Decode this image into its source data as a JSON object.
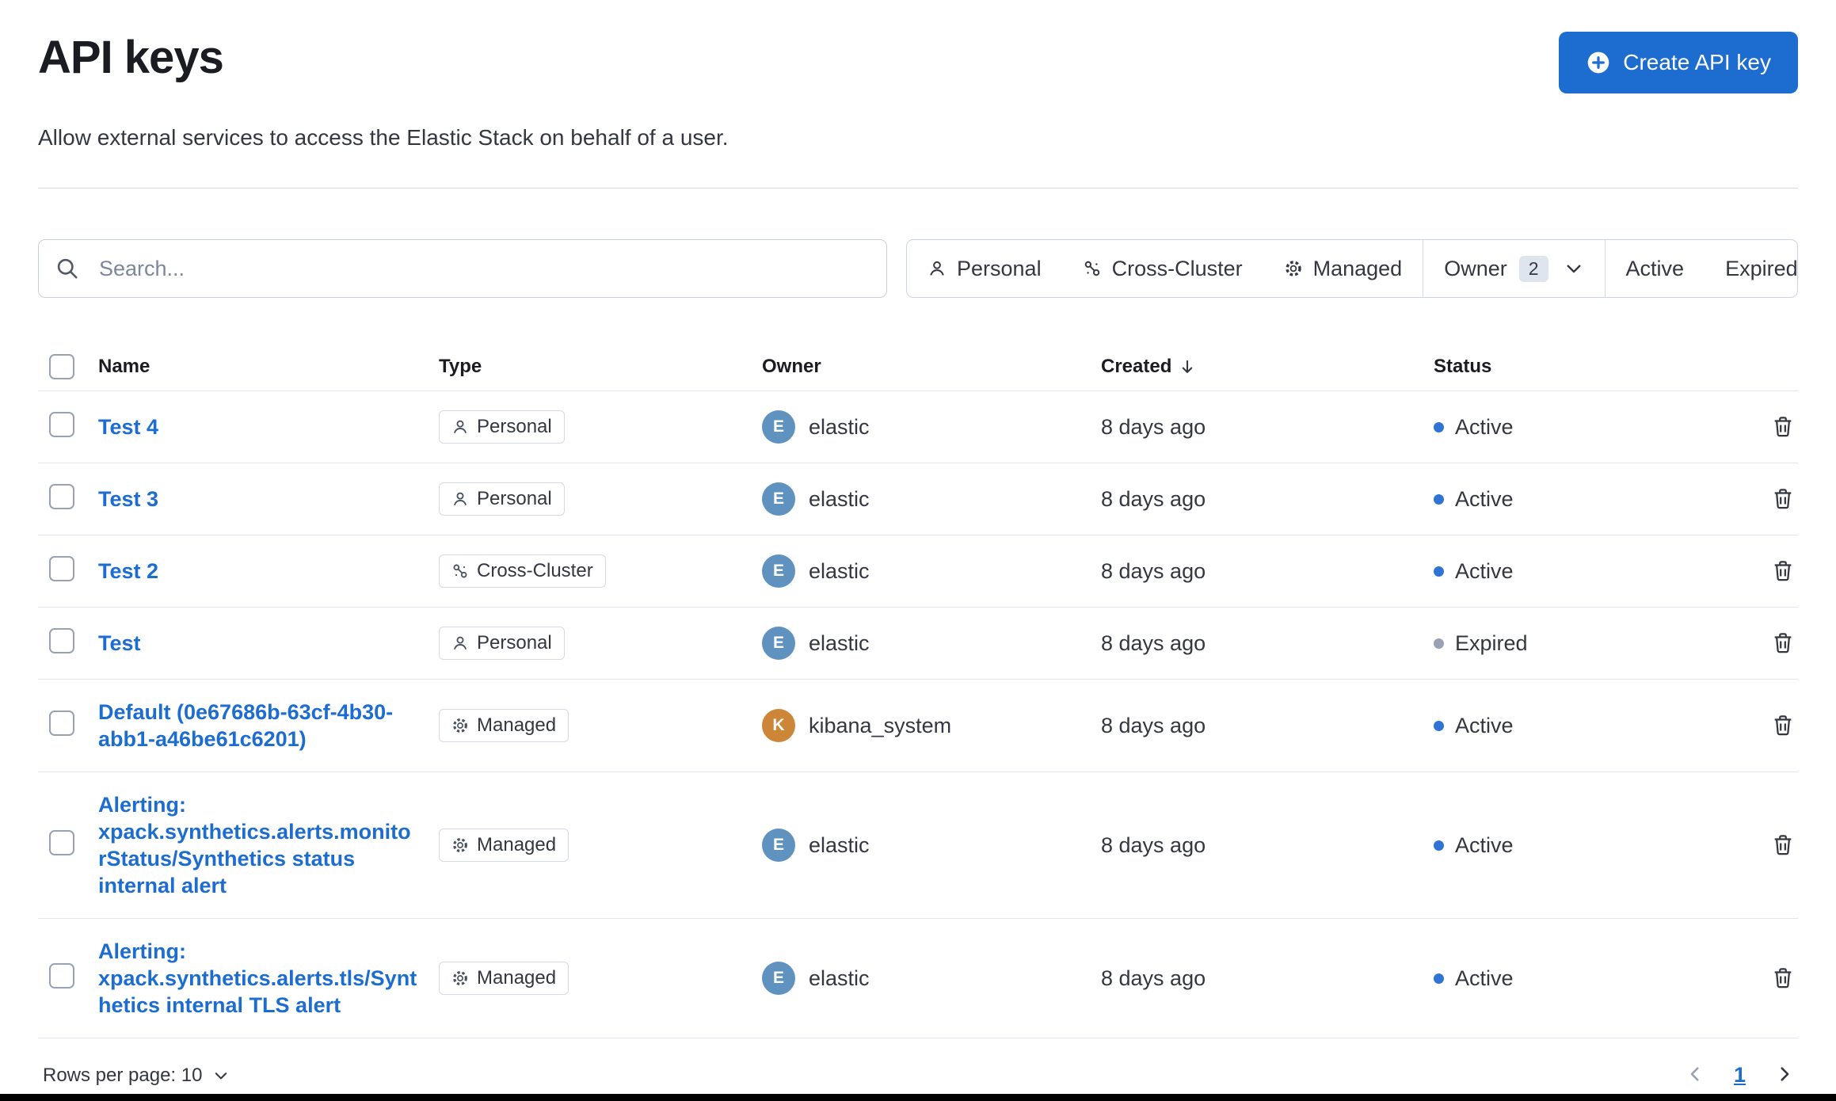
{
  "page": {
    "title": "API keys",
    "subtitle": "Allow external services to access the Elastic Stack on behalf of a user.",
    "create_button_label": "Create API key"
  },
  "search": {
    "placeholder": "Search..."
  },
  "filters": {
    "personal_label": "Personal",
    "cross_cluster_label": "Cross-Cluster",
    "managed_label": "Managed",
    "owner_label": "Owner",
    "owner_count": "2",
    "active_label": "Active",
    "expired_label": "Expired"
  },
  "table": {
    "headers": {
      "name": "Name",
      "type": "Type",
      "owner": "Owner",
      "created": "Created",
      "status": "Status"
    },
    "rows": [
      {
        "name": "Test 4",
        "type": "Personal",
        "type_icon": "user",
        "owner": "elastic",
        "avatar_letter": "E",
        "avatar_color": "#6092c0",
        "created": "8 days ago",
        "status": "Active",
        "status_color": "#2f74d4"
      },
      {
        "name": "Test 3",
        "type": "Personal",
        "type_icon": "user",
        "owner": "elastic",
        "avatar_letter": "E",
        "avatar_color": "#6092c0",
        "created": "8 days ago",
        "status": "Active",
        "status_color": "#2f74d4"
      },
      {
        "name": "Test 2",
        "type": "Cross-Cluster",
        "type_icon": "cross-cluster",
        "owner": "elastic",
        "avatar_letter": "E",
        "avatar_color": "#6092c0",
        "created": "8 days ago",
        "status": "Active",
        "status_color": "#2f74d4"
      },
      {
        "name": "Test",
        "type": "Personal",
        "type_icon": "user",
        "owner": "elastic",
        "avatar_letter": "E",
        "avatar_color": "#6092c0",
        "created": "8 days ago",
        "status": "Expired",
        "status_color": "#98a2b3"
      },
      {
        "name": "Default (0e67686b-63cf-4b30-abb1-a46be61c6201)",
        "type": "Managed",
        "type_icon": "gear",
        "owner": "kibana_system",
        "avatar_letter": "K",
        "avatar_color": "#cd8638",
        "created": "8 days ago",
        "status": "Active",
        "status_color": "#2f74d4"
      },
      {
        "name": "Alerting: xpack.synthetics.alerts.monitorStatus/Synthetics status internal alert",
        "type": "Managed",
        "type_icon": "gear",
        "owner": "elastic",
        "avatar_letter": "E",
        "avatar_color": "#6092c0",
        "created": "8 days ago",
        "status": "Active",
        "status_color": "#2f74d4"
      },
      {
        "name": "Alerting: xpack.synthetics.alerts.tls/Synthetics internal TLS alert",
        "type": "Managed",
        "type_icon": "gear",
        "owner": "elastic",
        "avatar_letter": "E",
        "avatar_color": "#6092c0",
        "created": "8 days ago",
        "status": "Active",
        "status_color": "#2f74d4"
      }
    ]
  },
  "footer": {
    "rows_per_page_label": "Rows per page: 10",
    "current_page": "1"
  },
  "colors": {
    "accent": "#1d6dd1",
    "border": "#d3dae6",
    "status_active": "#2f74d4",
    "status_expired": "#98a2b3",
    "avatar_elastic": "#6092c0",
    "avatar_kibana_system": "#cd8638"
  }
}
